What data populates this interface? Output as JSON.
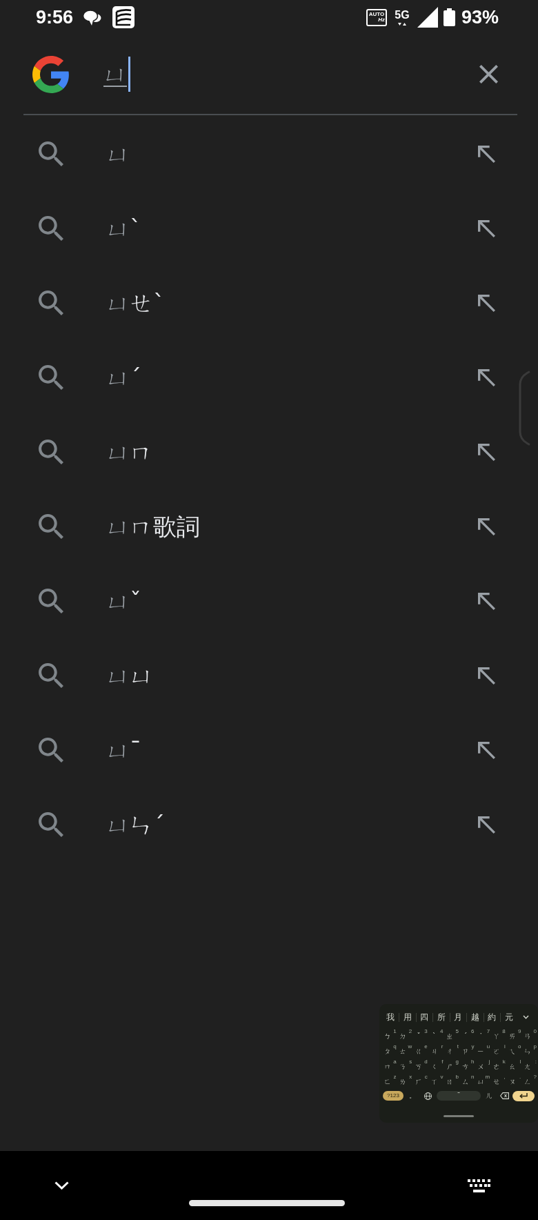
{
  "status_bar": {
    "time": "9:56",
    "refresh_badge": {
      "top": "AUTO",
      "bottom": "Hz"
    },
    "network": "5G",
    "battery": "93%"
  },
  "search": {
    "query": "ㄩ",
    "composing": true
  },
  "suggestions": [
    {
      "typed": "ㄩ"
    },
    {
      "typed": "ㄩ",
      "completion": "ˋ"
    },
    {
      "typed": "ㄩ",
      "completion": "ㄝˋ"
    },
    {
      "typed": "ㄩ",
      "completion": "ˊ"
    },
    {
      "typed": "ㄩ",
      "completion": "ㄇ"
    },
    {
      "typed": "ㄩ",
      "completion": "ㄇ歌詞"
    },
    {
      "typed": "ㄩ",
      "completion": "ˇ"
    },
    {
      "typed": "ㄩ",
      "completion": "ㄩ"
    },
    {
      "typed": "ㄩ",
      "completion": "ˉ"
    },
    {
      "typed": "ㄩ",
      "completion": "ㄣˊ"
    }
  ],
  "floating_keyboard": {
    "candidates": [
      "我",
      "用",
      "四",
      "所",
      "月",
      "越",
      "約",
      "元"
    ],
    "rows": [
      [
        {
          "label": "ㄅ",
          "hint": "1"
        },
        {
          "label": "ㄉ",
          "hint": "2"
        },
        {
          "label": "ˇ",
          "hint": "3"
        },
        {
          "label": "ˋ",
          "hint": "4"
        },
        {
          "label": "ㄓ",
          "hint": "5"
        },
        {
          "label": "ˊ",
          "hint": "6"
        },
        {
          "label": "˙",
          "hint": "7"
        },
        {
          "label": "ㄚ",
          "hint": "8"
        },
        {
          "label": "ㄞ",
          "hint": "9"
        },
        {
          "label": "ㄢ",
          "hint": "0"
        }
      ],
      [
        {
          "label": "ㄆ",
          "hint": "q"
        },
        {
          "label": "ㄊ",
          "hint": "w"
        },
        {
          "label": "ㄍ",
          "hint": "e"
        },
        {
          "label": "ㄐ",
          "hint": "r"
        },
        {
          "label": "ㄔ",
          "hint": "t"
        },
        {
          "label": "ㄗ",
          "hint": "y"
        },
        {
          "label": "ㄧ",
          "hint": "u"
        },
        {
          "label": "ㄛ",
          "hint": "i"
        },
        {
          "label": "ㄟ",
          "hint": "o"
        },
        {
          "label": "ㄣ",
          "hint": "p"
        }
      ],
      [
        {
          "label": "ㄇ",
          "hint": "a"
        },
        {
          "label": "ㄋ",
          "hint": "s"
        },
        {
          "label": "ㄎ",
          "hint": "d"
        },
        {
          "label": "ㄑ",
          "hint": "f"
        },
        {
          "label": "ㄕ",
          "hint": "g"
        },
        {
          "label": "ㄘ",
          "hint": "h"
        },
        {
          "label": "ㄨ",
          "hint": "j"
        },
        {
          "label": "ㄜ",
          "hint": "k"
        },
        {
          "label": "ㄠ",
          "hint": "l"
        },
        {
          "label": "ㄤ",
          "hint": ":"
        }
      ],
      [
        {
          "label": "ㄈ",
          "hint": "z"
        },
        {
          "label": "ㄌ",
          "hint": "x"
        },
        {
          "label": "ㄏ",
          "hint": "c"
        },
        {
          "label": "ㄒ",
          "hint": "v"
        },
        {
          "label": "ㄖ",
          "hint": "b"
        },
        {
          "label": "ㄙ",
          "hint": "n"
        },
        {
          "label": "ㄩ",
          "hint": "m"
        },
        {
          "label": "ㄝ",
          "hint": ","
        },
        {
          "label": "ㄡ",
          "hint": "."
        },
        {
          "label": "ㄥ",
          "hint": "?"
        }
      ]
    ],
    "bottom_row": [
      {
        "kind": "symbols",
        "label": "?123"
      },
      {
        "kind": "char",
        "label": "。"
      },
      {
        "kind": "language"
      },
      {
        "kind": "space",
        "label": "ˉ"
      },
      {
        "kind": "char",
        "label": "ㄦ"
      },
      {
        "kind": "backspace"
      },
      {
        "kind": "enter"
      }
    ]
  }
}
